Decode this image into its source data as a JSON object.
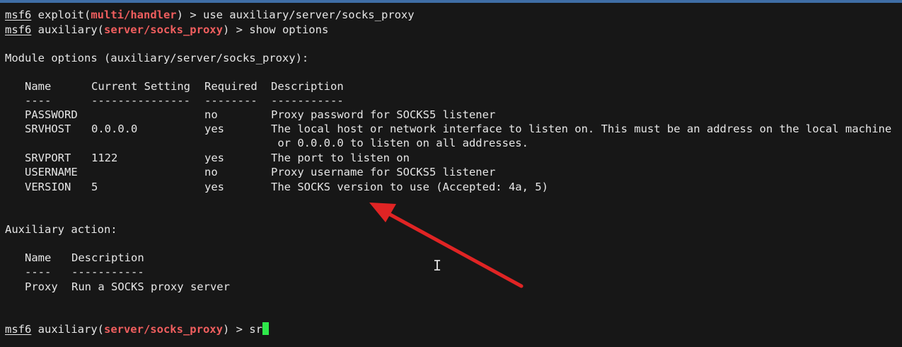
{
  "terminal": {
    "prompt": "msf6",
    "line1": {
      "pre": " exploit(",
      "module": "multi/handler",
      "post": ") > use auxiliary/server/socks_proxy"
    },
    "line2": {
      "pre": " auxiliary(",
      "module": "server/socks_proxy",
      "post": ") > show options"
    },
    "module_options_heading": "Module options (auxiliary/server/socks_proxy):",
    "options_table": {
      "headers": [
        "Name",
        "Current Setting",
        "Required",
        "Description"
      ],
      "separators": [
        "----",
        "---------------",
        "--------",
        "-----------"
      ],
      "rows": [
        {
          "name": "PASSWORD",
          "setting": "",
          "required": "no",
          "description": "Proxy password for SOCKS5 listener",
          "description2": ""
        },
        {
          "name": "SRVHOST",
          "setting": "0.0.0.0",
          "required": "yes",
          "description": "The local host or network interface to listen on. This must be an address on the local machine",
          "description2": " or 0.0.0.0 to listen on all addresses."
        },
        {
          "name": "SRVPORT",
          "setting": "1122",
          "required": "yes",
          "description": "The port to listen on",
          "description2": ""
        },
        {
          "name": "USERNAME",
          "setting": "",
          "required": "no",
          "description": "Proxy username for SOCKS5 listener",
          "description2": ""
        },
        {
          "name": "VERSION",
          "setting": "5",
          "required": "yes",
          "description": "The SOCKS version to use (Accepted: 4a, 5)",
          "description2": ""
        }
      ]
    },
    "auxiliary_action_heading": "Auxiliary action:",
    "action_table": {
      "headers": [
        "Name",
        "Description"
      ],
      "separators": [
        "----",
        "-----------"
      ],
      "rows": [
        {
          "name": "Proxy",
          "description": "Run a SOCKS proxy server"
        }
      ]
    },
    "current_line": {
      "pre": " auxiliary(",
      "module": "server/socks_proxy",
      "post": ") > ",
      "input": "sr"
    }
  },
  "annotation": {
    "arrow_color": "#e02424"
  },
  "colors": {
    "background": "#171717",
    "text": "#e6e6e6",
    "module": "#ef5e5e",
    "cursor": "#2ee84a"
  }
}
